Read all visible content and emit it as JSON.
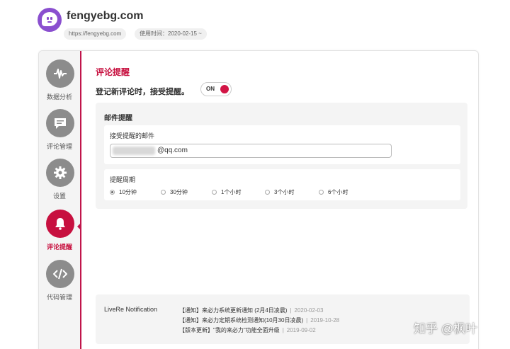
{
  "header": {
    "site_title": "fengyebg.com",
    "url_pill": "https://fengyebg.com",
    "usage_pill": "使用时间：2020-02-15 ~"
  },
  "sidebar": {
    "items": [
      {
        "label": "数据分析",
        "icon": "waveform-icon"
      },
      {
        "label": "评论管理",
        "icon": "comment-icon"
      },
      {
        "label": "设置",
        "icon": "gear-icon"
      },
      {
        "label": "评论提醒",
        "icon": "bell-icon",
        "active": true
      },
      {
        "label": "代码管理",
        "icon": "code-icon"
      }
    ]
  },
  "main": {
    "section_title": "评论提醒",
    "notify_label": "登记新评论时，接受提醒。",
    "toggle_label": "ON",
    "mail": {
      "title": "邮件提醒",
      "receive_label": "接受提醒的邮件",
      "email_value": "@qq.com",
      "cycle_label": "提醒周期",
      "options": [
        "10分钟",
        "30分钟",
        "1个小时",
        "3个小时",
        "6个小时"
      ],
      "selected": "10分钟"
    },
    "livere": {
      "title": "LiveRe Notification",
      "items": [
        {
          "text": "【通知】来必力系统更新通知 (2月4日凌晨)",
          "date": "2020-02-03"
        },
        {
          "text": "【通知】来必力定期系统检测通知(10月30日凌晨)",
          "date": "2019-10-28"
        },
        {
          "text": "【版本更新】\"我的来必力\"功能全面升级",
          "date": "2019-09-02"
        }
      ]
    }
  },
  "watermark": "知乎 @枫叶",
  "colors": {
    "accent": "#c7103f",
    "logo": "#8a4fcf",
    "nav_inactive": "#8c8c8c"
  }
}
